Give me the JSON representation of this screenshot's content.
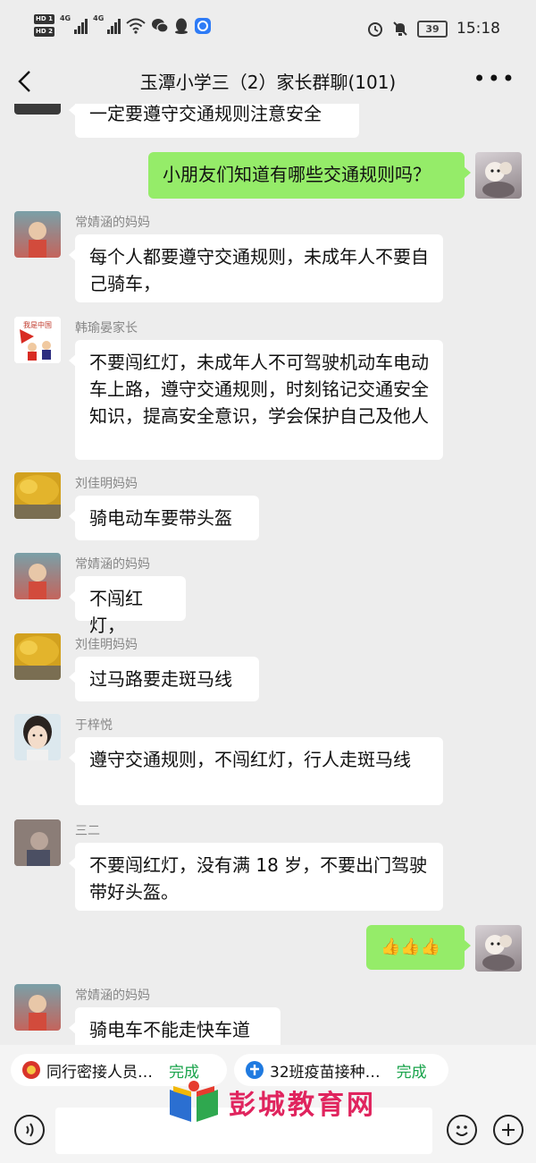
{
  "status_bar": {
    "time": "15:18",
    "battery": "39",
    "sim1": "HD 1",
    "sim2": "HD 2",
    "net1": "4G",
    "net2": "4G"
  },
  "header": {
    "title": "玉潭小学三（2）家长群聊(101)"
  },
  "messages": [
    {
      "side": "left",
      "sender": "",
      "text": "一定要遵守交通规则注意安全"
    },
    {
      "side": "right",
      "sender": "",
      "text": "小朋友们知道有哪些交通规则吗？"
    },
    {
      "side": "left",
      "sender": "常婧涵的妈妈",
      "text": "每个人都要遵守交通规则，未成年人不要自己骑车，"
    },
    {
      "side": "left",
      "sender": "韩瑜晏家长",
      "text": "不要闯红灯，未成年人不可驾驶机动车电动车上路，遵守交通规则，时刻铭记交通安全知识，提高安全意识，学会保护自己及他人"
    },
    {
      "side": "left",
      "sender": "刘佳明妈妈",
      "text": "骑电动车要带头盔"
    },
    {
      "side": "left",
      "sender": "常婧涵的妈妈",
      "text": "不闯红灯，"
    },
    {
      "side": "left",
      "sender": "刘佳明妈妈",
      "text": "过马路要走斑马线"
    },
    {
      "side": "left",
      "sender": "于梓悦",
      "text": "遵守交通规则，不闯红灯，行人走斑马线"
    },
    {
      "side": "left",
      "sender": "三二",
      "text": "不要闯红灯，没有满 18 岁，不要出门驾驶带好头盔。"
    },
    {
      "side": "right",
      "sender": "",
      "text": "👍👍👍"
    },
    {
      "side": "left",
      "sender": "常婧涵的妈妈",
      "text": "骑电车不能走快车道"
    }
  ],
  "tasks": [
    {
      "label": "同行密接人员…",
      "status": "完成",
      "icon": "badge-icon"
    },
    {
      "label": "32班疫苗接种…",
      "status": "完成",
      "icon": "vaccine-icon"
    }
  ],
  "watermark": "彭城教育网",
  "colors": {
    "background": "#ededed",
    "self_bubble": "#95ec69",
    "other_bubble": "#ffffff",
    "done": "#18a34a",
    "watermark": "#e0245e"
  }
}
